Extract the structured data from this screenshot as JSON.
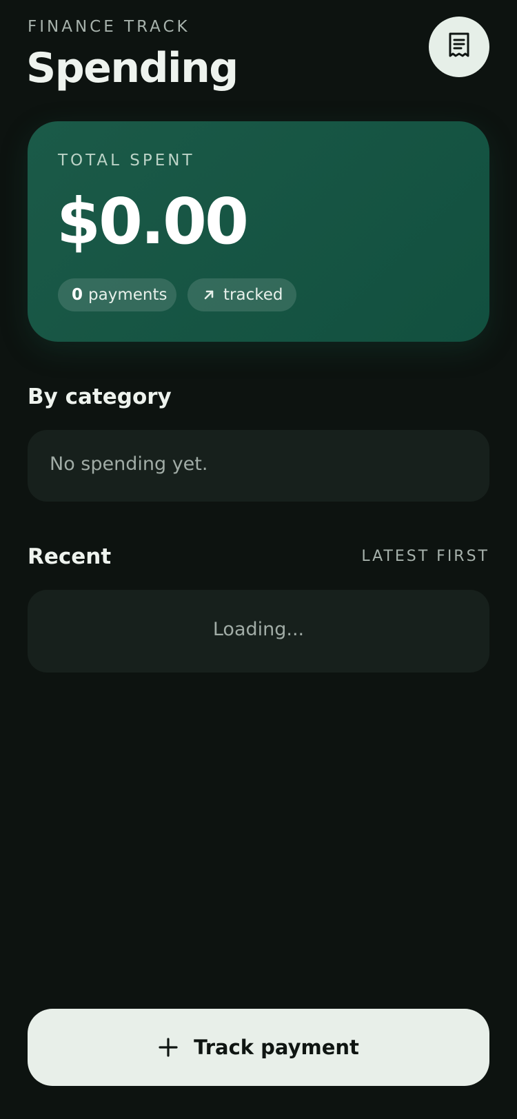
{
  "header": {
    "eyebrow": "FINANCE TRACK",
    "title": "Spending",
    "receipt_icon": "receipt-icon"
  },
  "summary": {
    "label": "TOTAL SPENT",
    "amount": "$0.00",
    "payments_count": "0",
    "payments_label": "payments",
    "tracked_label": "tracked",
    "tracked_icon": "arrow-up-right-icon"
  },
  "category": {
    "title": "By category",
    "empty": "No spending yet."
  },
  "recent": {
    "title": "Recent",
    "sort_label": "LATEST FIRST",
    "loading": "Loading..."
  },
  "actions": {
    "track_payment_label": "Track payment",
    "track_payment_icon": "plus-icon"
  },
  "colors": {
    "background": "#0d1310",
    "card_green": "#1b5a48",
    "panel": "#17201c",
    "button_light": "#e8efe9"
  }
}
